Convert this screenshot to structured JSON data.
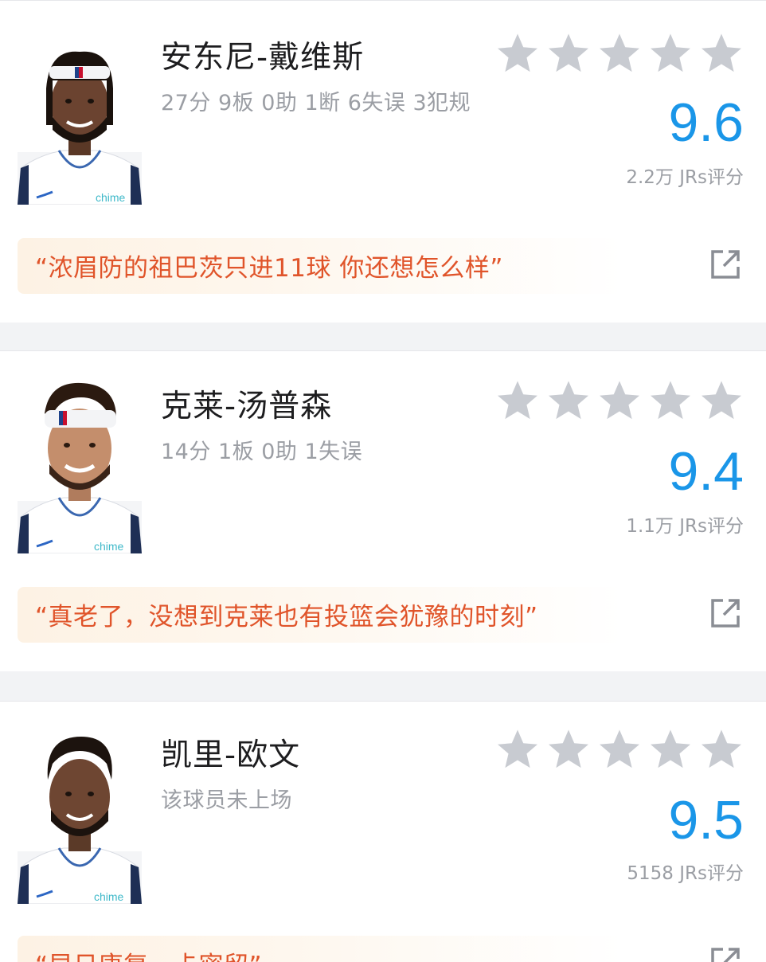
{
  "players": [
    {
      "name": "安东尼-戴维斯",
      "stats": "27分 9板 0助 1断 6失误 3犯规",
      "score": "9.6",
      "rating_count": "2.2万 JRs评分",
      "comment": "“浓眉防的祖巴茨只进11球 你还想怎么样”",
      "star_count": 5
    },
    {
      "name": "克莱-汤普森",
      "stats": "14分 1板 0助 1失误",
      "score": "9.4",
      "rating_count": "1.1万 JRs评分",
      "comment": "“真老了，没想到克莱也有投篮会犹豫的时刻”",
      "star_count": 5
    },
    {
      "name": "凯里-欧文",
      "stats": "该球员未上场",
      "score": "9.5",
      "rating_count": "5158 JRs评分",
      "comment": "“早日康复，卡密留”",
      "star_count": 5
    }
  ],
  "colors": {
    "score": "#1a96e8",
    "comment_text": "#e0542a",
    "star": "#c8cbd1",
    "stats_text": "#9b9ea4",
    "jersey_logo": "chime"
  },
  "icons": {
    "star": "star-icon",
    "share": "share-icon"
  }
}
